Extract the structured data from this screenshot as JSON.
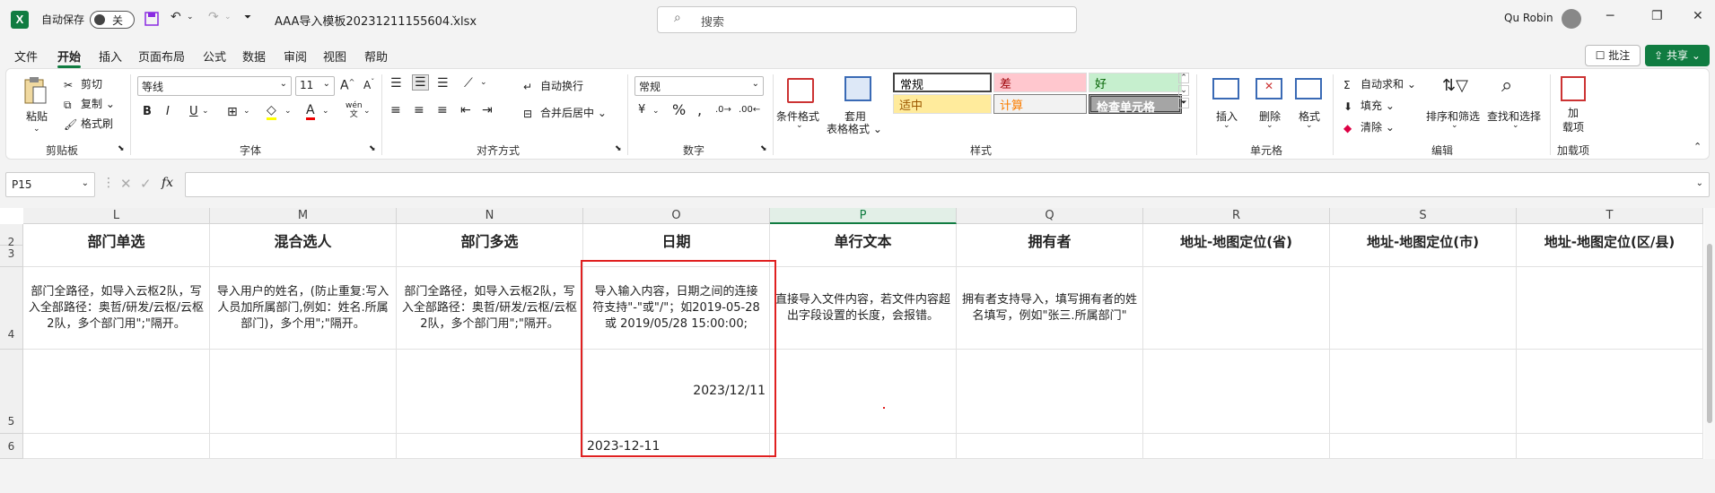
{
  "titlebar": {
    "app_icon": "excel-icon",
    "autosave_label": "自动保存",
    "autosave_state": "关",
    "filename": "AAA导入模板20231211155604.xlsx",
    "search_placeholder": "搜索",
    "user_name": "Qu Robin"
  },
  "menu": {
    "items": [
      "文件",
      "开始",
      "插入",
      "页面布局",
      "公式",
      "数据",
      "审阅",
      "视图",
      "帮助"
    ],
    "active": "开始",
    "comment_label": "批注",
    "share_label": "共享"
  },
  "ribbon": {
    "clipboard": {
      "label": "剪贴板",
      "paste": "粘贴",
      "cut": "剪切",
      "copy": "复制",
      "format_painter": "格式刷"
    },
    "font": {
      "label": "字体",
      "font_name": "等线",
      "font_size": "11",
      "bold": "B",
      "italic": "I",
      "underline": "U",
      "phonetic": "wén"
    },
    "alignment": {
      "label": "对齐方式",
      "wrap": "自动换行",
      "merge": "合并后居中"
    },
    "number": {
      "label": "数字",
      "format": "常规"
    },
    "styles": {
      "label": "样式",
      "conditional": "条件格式",
      "table_format": "套用",
      "table_format2": "表格格式",
      "cells": [
        {
          "name": "常规",
          "bg": "#ffffff",
          "color": "#000000"
        },
        {
          "name": "差",
          "bg": "#ffc7ce",
          "color": "#9c0006"
        },
        {
          "name": "好",
          "bg": "#c6efce",
          "color": "#006100"
        },
        {
          "name": "适中",
          "bg": "#ffeb9c",
          "color": "#9c5700"
        },
        {
          "name": "计算",
          "bg": "#f2f2f2",
          "color": "#fa7d00"
        },
        {
          "name": "检查单元格",
          "bg": "#a5a5a5",
          "color": "#ffffff"
        }
      ]
    },
    "cells": {
      "label": "单元格",
      "insert": "插入",
      "delete": "删除",
      "format": "格式"
    },
    "editing": {
      "label": "编辑",
      "autosum": "自动求和",
      "fill": "填充",
      "clear": "清除",
      "sort": "排序和筛选",
      "find": "查找和选择"
    },
    "addins": {
      "label": "加载项",
      "btn1": "加",
      "btn2": "载项"
    }
  },
  "formula_bar": {
    "name_box": "P15",
    "fx": "fx",
    "content": ""
  },
  "grid": {
    "columns": [
      "L",
      "M",
      "N",
      "O",
      "P",
      "Q",
      "R",
      "S",
      "T"
    ],
    "selected_column": "P",
    "rows": [
      "2",
      "3",
      "4",
      "5",
      "6"
    ],
    "headers": [
      "部门单选",
      "混合选人",
      "部门多选",
      "日期",
      "单行文本",
      "拥有者",
      "地址-地图定位(省)",
      "地址-地图定位(市)",
      "地址-地图定位(区/县)"
    ],
    "descriptions": [
      "部门全路径，如导入云枢2队，写入全部路径：奥哲/研发/云枢/云枢2队，多个部门用\";\"隔开。",
      "导入用户的姓名，(防止重复:写入人员加所属部门,例如：姓名.所属部门)，多个用\";\"隔开。",
      "部门全路径，如导入云枢2队，写入全部路径：奥哲/研发/云枢/云枢2队，多个部门用\";\"隔开。",
      "导入输入内容，日期之间的连接符支持\"-\"或\"/\"；如2019-05-28 或 2019/05/28 15:00:00;",
      "直接导入文件内容，若文件内容超出字段设置的长度，会报错。",
      "拥有者支持导入，填写拥有者的姓名填写，例如\"张三.所属部门\"",
      "",
      "",
      ""
    ],
    "date_value_row5": "2023/12/11",
    "date_value_row6": "2023-12-11"
  }
}
